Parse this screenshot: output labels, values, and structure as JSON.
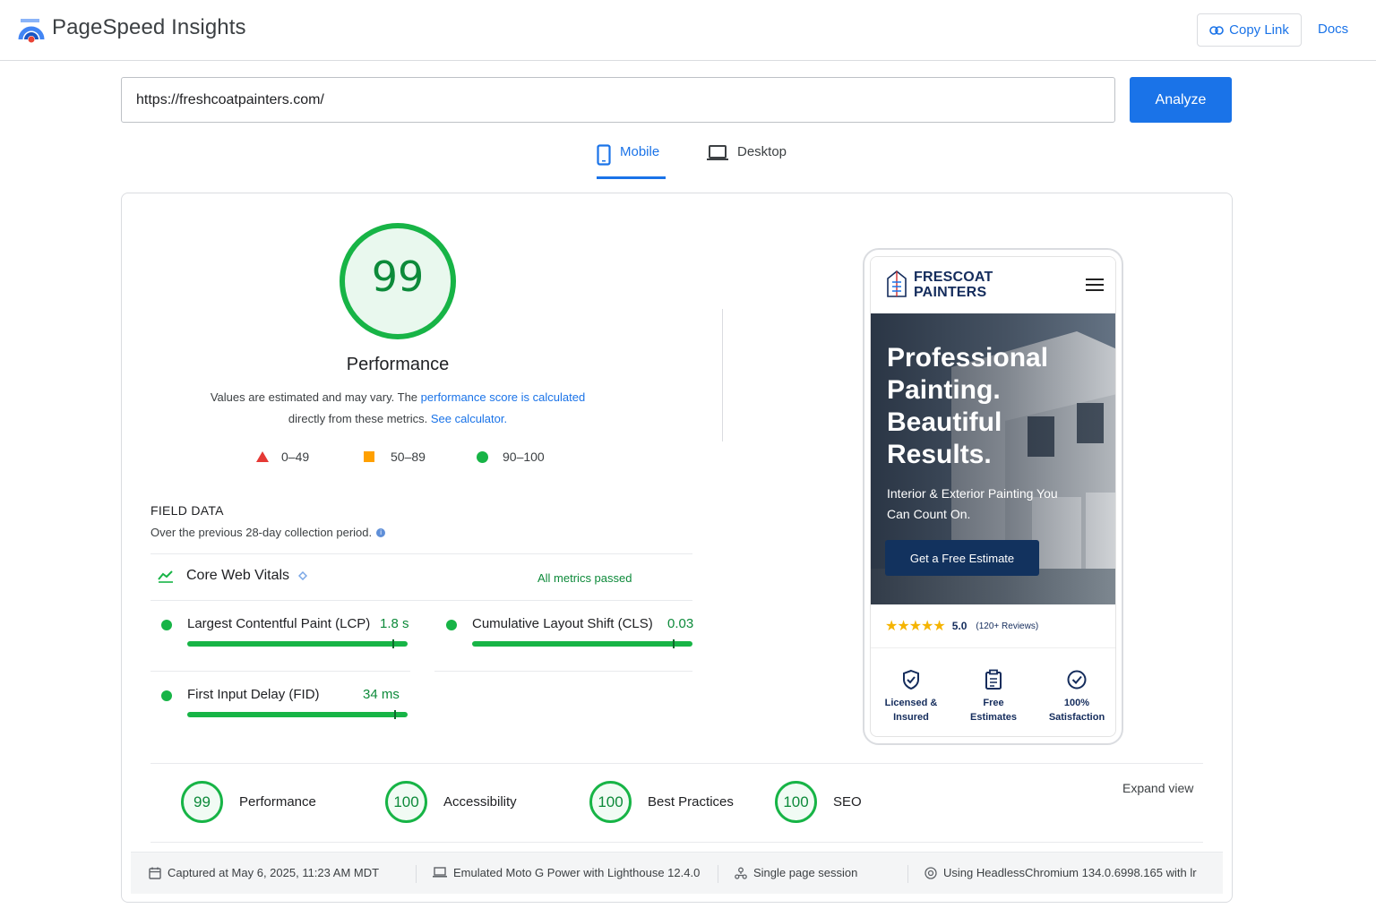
{
  "header": {
    "brand": "PageSpeed Insights",
    "copy_link_label": "Copy Link",
    "docs_label": "Docs"
  },
  "search": {
    "url_value": "https://freshcoatpainters.com/",
    "analyze_label": "Analyze"
  },
  "tabs": [
    {
      "label": "Mobile",
      "selected": true
    },
    {
      "label": "Desktop",
      "selected": false
    }
  ],
  "performance": {
    "score": "99",
    "title": "Performance",
    "desc_prefix": "Values are estimated and may vary. The ",
    "desc_link1": "performance score is calculated",
    "desc_mid": "directly from these metrics. ",
    "desc_link2": "See calculator.",
    "legend": [
      {
        "shape": "triangle",
        "range": "0–49",
        "color": "#e53935"
      },
      {
        "shape": "square",
        "range": "50–89",
        "color": "#ffa000"
      },
      {
        "shape": "circle",
        "range": "90–100",
        "color": "#17b446"
      }
    ]
  },
  "field_data": {
    "title": "FIELD DATA",
    "subtitle": "Over the previous 28-day collection period.",
    "cwv_label": "Core Web Vitals",
    "cwv_status": "All metrics passed",
    "metrics": [
      {
        "label": "Largest Contentful Paint (LCP)",
        "value": "1.8 s"
      },
      {
        "label": "Cumulative Layout Shift (CLS)",
        "value": "0.03"
      },
      {
        "label": "First Input Delay (FID)",
        "value": "34 ms"
      }
    ]
  },
  "preview": {
    "site_name_line1": "FRESCOAT",
    "site_name_line2": "PAINTERS",
    "hero_title": "Professional Painting. Beautiful Results.",
    "hero_sub": "Interior & Exterior Painting You Can Count On.",
    "hero_button": "Get a Free Estimate",
    "stars": "★★★★★",
    "rating": "5.0",
    "review_count": "(120+ Reviews)",
    "features": [
      {
        "line1": "Licensed &",
        "line2": "Insured",
        "icon": "shield-check-icon"
      },
      {
        "line1": "Free",
        "line2": "Estimates",
        "icon": "clipboard-icon"
      },
      {
        "line1": "100%",
        "line2": "Satisfaction",
        "icon": "check-circle-icon"
      }
    ]
  },
  "categories": [
    {
      "score": "99",
      "label": "Performance"
    },
    {
      "score": "100",
      "label": "Accessibility"
    },
    {
      "score": "100",
      "label": "Best Practices"
    },
    {
      "score": "100",
      "label": "SEO"
    }
  ],
  "expand_label": "Expand view",
  "run_info": {
    "captured": "Captured at May 6, 2025, 11:23 AM MDT",
    "device": "Emulated Moto G Power with Lighthouse 12.4.0",
    "session": "Single page session",
    "browser": "Using HeadlessChromium 134.0.6998.165 with lr"
  },
  "colors": {
    "accent": "#1a73e8",
    "pass": "#17b446",
    "pass_text": "#0d8a3a",
    "site_navy": "#142c5c"
  }
}
